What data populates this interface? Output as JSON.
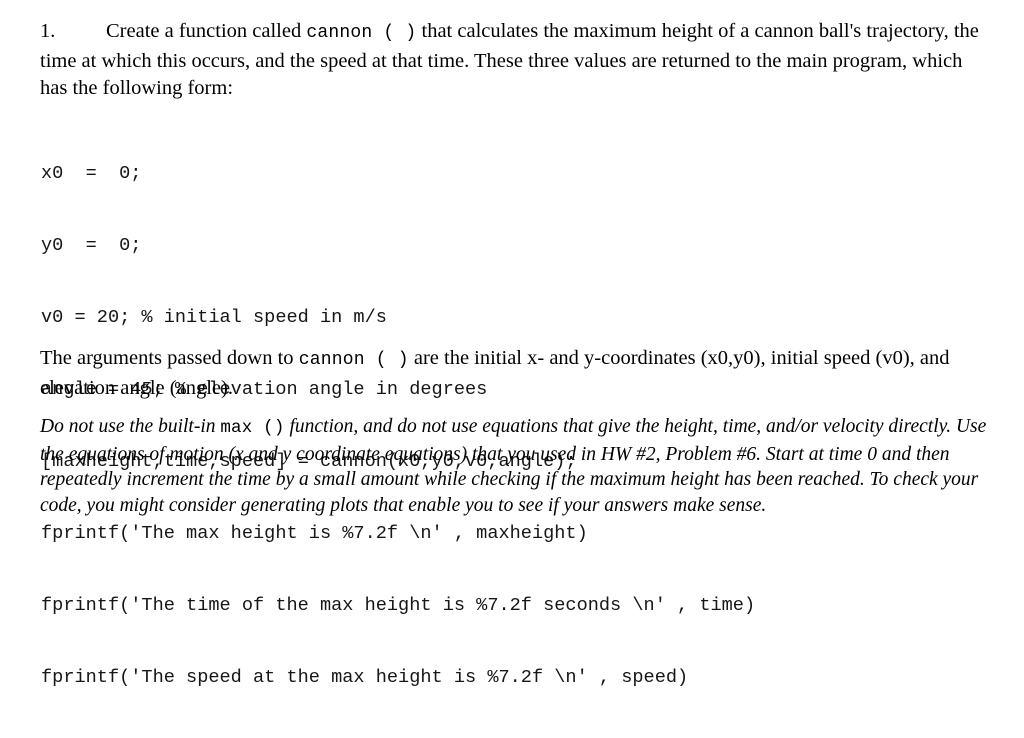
{
  "document": {
    "problem_number": "1.",
    "intro": {
      "before_code": "Create a function called ",
      "code_inline": "cannon ( )",
      "after_code": " that calculates the maximum height of a cannon ball's trajectory, the time at which this occurs, and the speed at that time. These three values are returned to the main program, which has the following form:"
    },
    "code_listing": {
      "language": "matlab",
      "lines": [
        "x0  =  0;",
        "y0  =  0;",
        "v0 = 20; % initial speed in m/s",
        "angle = 45; % elevation angle in degrees",
        "[maxheight,time,speed] = cannon(x0,y0,v0,angle);",
        "fprintf('The max height is %7.2f \\n' , maxheight)",
        "fprintf('The time of the max height is %7.2f seconds \\n' , time)",
        "fprintf('The speed at the max height is %7.2f \\n' , speed)"
      ]
    },
    "arguments_paragraph": {
      "before_code": "The arguments passed down to ",
      "code_inline": "cannon ( )",
      "after_code": " are the initial x- and y-coordinates (x0,y0), initial speed (v0), and elevation angle (angle)."
    },
    "note_paragraph": {
      "before_code": "Do not use the built-in ",
      "code_inline": "max ()",
      "after_code": " function, and do not use equations that give the height, time, and/or velocity directly. Use the equations of motion (x and y coordinate equations) that you used in HW #2, Problem #6. Start at time 0 and then repeatedly increment the time by a small amount while checking if the maximum height has been reached. To check your code, you might consider generating plots that enable you to see if your answers make sense."
    },
    "colors": {
      "page_background": "#ffffff",
      "body_text": "#000000",
      "code_text": "#161616"
    }
  }
}
